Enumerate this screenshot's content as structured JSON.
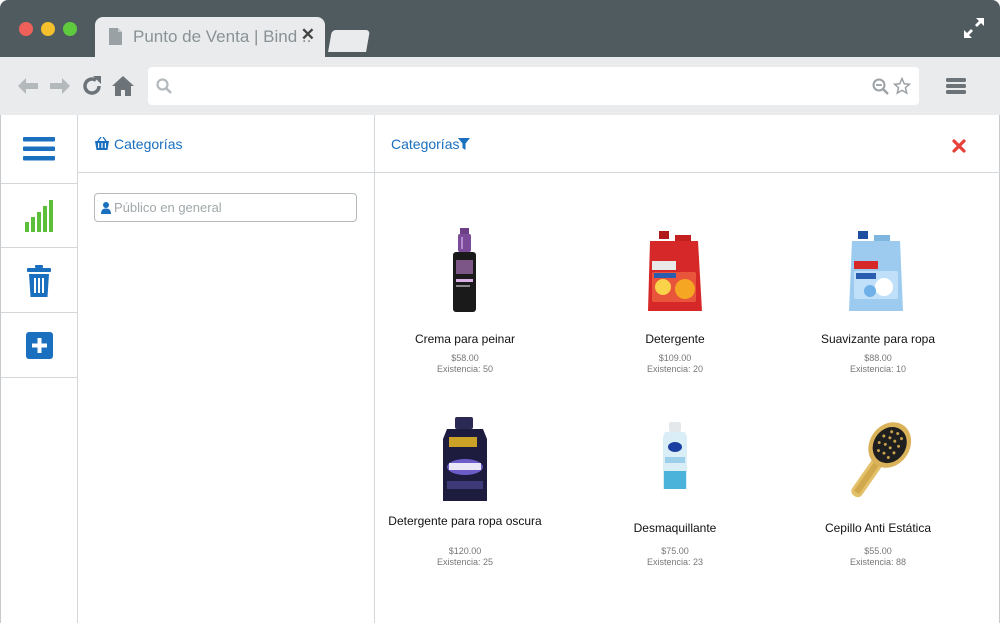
{
  "browser": {
    "tab_title": "Punto de Venta | Bind ..",
    "tab_close": "✕",
    "url": ""
  },
  "sidebar": {
    "items": [
      {
        "icon": "hamburger-menu-icon"
      },
      {
        "icon": "signal-bars-icon"
      },
      {
        "icon": "trash-icon"
      },
      {
        "icon": "add-square-icon"
      }
    ]
  },
  "cart_panel": {
    "title": "Categorías",
    "client_placeholder": "Público en general"
  },
  "catalog": {
    "title": "Categorías",
    "products": [
      {
        "name": "Crema para peinar",
        "price": "$58.00",
        "stock": "Existencia: 50",
        "icon": "hair-cream-bottle"
      },
      {
        "name": "Detergente",
        "price": "$109.00",
        "stock": "Existencia: 20",
        "icon": "detergent-jug-red"
      },
      {
        "name": "Suavizante para ropa",
        "price": "$88.00",
        "stock": "Existencia: 10",
        "icon": "softener-jug-blue"
      },
      {
        "name": "Detergente para ropa oscura",
        "price": "$120.00",
        "stock": "Existencia: 25",
        "icon": "dark-detergent-bottle"
      },
      {
        "name": "Desmaquillante",
        "price": "$75.00",
        "stock": "Existencia: 23",
        "icon": "makeup-remover-bottle"
      },
      {
        "name": "Cepillo Anti Estática",
        "price": "$55.00",
        "stock": "Existencia: 88",
        "icon": "hair-brush"
      }
    ]
  },
  "colors": {
    "accent": "#1a6fbf",
    "close_red": "#e8403a",
    "signal_green": "#5bbf3a"
  }
}
